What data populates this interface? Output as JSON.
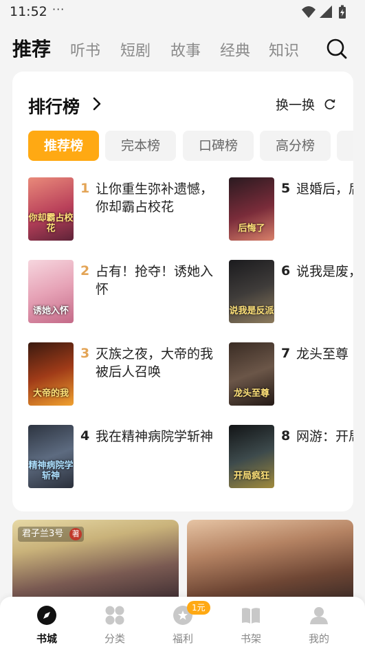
{
  "status_bar": {
    "time": "11:52",
    "dots": "···"
  },
  "top_nav": {
    "tabs": [
      {
        "label": "推荐",
        "active": true
      },
      {
        "label": "听书"
      },
      {
        "label": "短剧"
      },
      {
        "label": "故事"
      },
      {
        "label": "经典"
      },
      {
        "label": "知识"
      }
    ]
  },
  "ranking": {
    "title": "排行榜",
    "refresh_label": "换一换",
    "tabs": [
      {
        "label": "推荐榜",
        "active": true
      },
      {
        "label": "完本榜"
      },
      {
        "label": "口碑榜"
      },
      {
        "label": "高分榜"
      }
    ],
    "books": [
      {
        "rank": "1",
        "title": "让你重生弥补遗憾，你却霸占校花",
        "cover_text": "你却霸占校花"
      },
      {
        "rank": "2",
        "title": "占有！抢夺！诱她入怀",
        "cover_text": "诱她入怀"
      },
      {
        "rank": "3",
        "title": "灭族之夜，大帝的我被后人召唤",
        "cover_text": "大帝的我"
      },
      {
        "rank": "4",
        "title": "我在精神病院学斩神",
        "cover_text": "精神病院学斩神"
      },
      {
        "rank": "5",
        "title": "退婚后，后悔了",
        "cover_text": "后悔了"
      },
      {
        "rank": "6",
        "title": "说我是废，竟然成真",
        "cover_text": "说我是反派"
      },
      {
        "rank": "7",
        "title": "龙头至尊",
        "cover_text": "龙头至尊"
      },
      {
        "rank": "8",
        "title": "网游：开局疯狂",
        "cover_text": "开局疯狂"
      }
    ]
  },
  "banners": [
    {
      "author": "君子兰3号",
      "badge": "著"
    },
    {
      "author": ""
    }
  ],
  "bottom_nav": [
    {
      "label": "书城",
      "icon": "compass-icon",
      "active": true
    },
    {
      "label": "分类",
      "icon": "grid-icon"
    },
    {
      "label": "福利",
      "icon": "gift-icon",
      "badge": "1元"
    },
    {
      "label": "书架",
      "icon": "bookshelf-icon"
    },
    {
      "label": "我的",
      "icon": "profile-icon"
    }
  ],
  "colors": {
    "accent": "#ffa913",
    "rank_top": "#e3a456",
    "background": "#f4f4f4"
  }
}
